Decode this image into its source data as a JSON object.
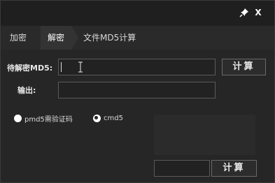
{
  "titlebar": {
    "pin_icon": "pin-icon",
    "close_label": "X"
  },
  "tabs": [
    {
      "label": "加密"
    },
    {
      "label": "解密"
    },
    {
      "label": "文件MD5计算"
    }
  ],
  "active_tab": 1,
  "decrypt": {
    "input_label": "待解密MD5:",
    "input_value": "",
    "output_label": "输出:",
    "output_value": "",
    "calc_button": "计算",
    "radio_options": [
      {
        "label": "pmd5需验证码",
        "checked": false
      },
      {
        "label": "cmd5",
        "checked": true
      }
    ],
    "code_value": "",
    "calc_button_2": "计算"
  },
  "colors": {
    "background": "#262626",
    "titlebar": "#1f1f1f",
    "active_tab": "#333333"
  }
}
